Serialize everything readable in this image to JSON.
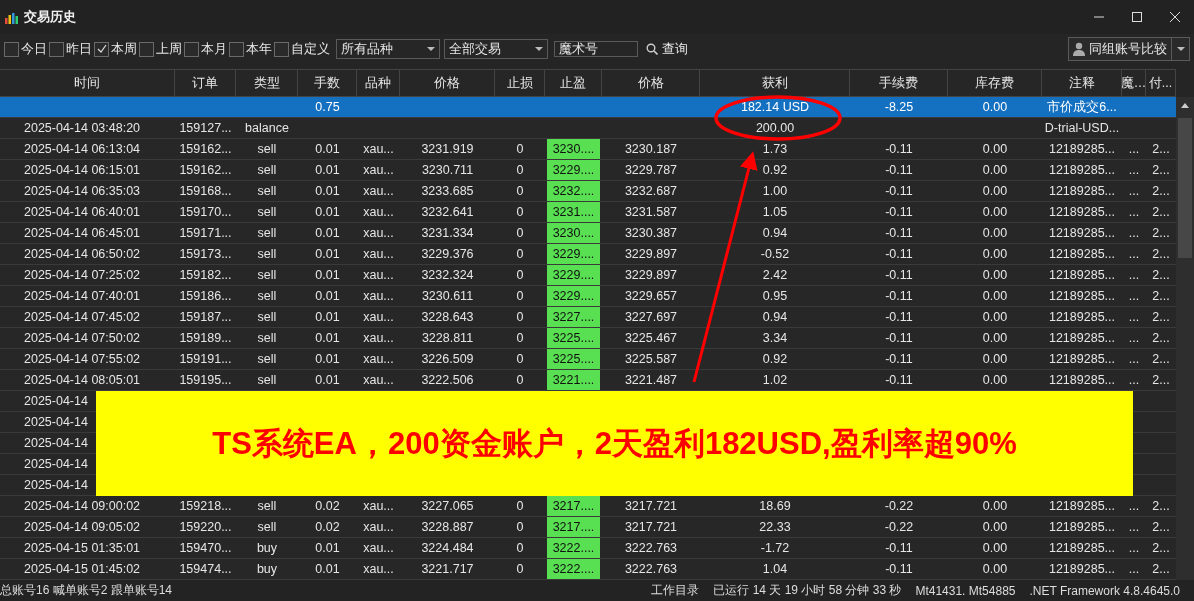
{
  "window": {
    "title": "交易历史"
  },
  "filters": [
    {
      "label": "今日",
      "checked": false
    },
    {
      "label": "昨日",
      "checked": false
    },
    {
      "label": "本周",
      "checked": true
    },
    {
      "label": "上周",
      "checked": false
    },
    {
      "label": "本月",
      "checked": false
    },
    {
      "label": "本年",
      "checked": false
    },
    {
      "label": "自定义",
      "checked": false
    }
  ],
  "dropdowns": [
    "所有品种",
    "全部交易"
  ],
  "magic_field": {
    "placeholder": "魔术号"
  },
  "search_button": "查询",
  "compare_button": "同组账号比较",
  "table": {
    "columns": [
      "时间",
      "订单",
      "类型",
      "手数",
      "品种",
      "价格",
      "止损",
      "止盈",
      "价格",
      "获利",
      "手续费",
      "库存费",
      "注释",
      "魔…",
      "付..."
    ],
    "rows": [
      {
        "selected": true,
        "lots": "0.75",
        "profit": "182.14 USD",
        "commission": "-8.25",
        "swap": "0.00",
        "comment": "市价成交6..."
      },
      {
        "selected": false,
        "time": "2025-04-14 03:48:20",
        "order": "159127...",
        "type": "balance",
        "profit": "200.00",
        "comment": "D-trial-USD..."
      },
      {
        "selected": false,
        "time": "2025-04-14 06:13:04",
        "order": "159162...",
        "type": "sell",
        "lots": "0.01",
        "symbol": "xau...",
        "price": "3231.919",
        "sl": "0",
        "tp": "3230....",
        "close_price": "3230.187",
        "profit": "1.73",
        "commission": "-0.11",
        "swap": "0.00",
        "comment": "12189285...",
        "column_14": "...",
        "column_15": "2..."
      },
      {
        "selected": false,
        "time": "2025-04-14 06:15:01",
        "order": "159162...",
        "type": "sell",
        "lots": "0.01",
        "symbol": "xau...",
        "price": "3230.711",
        "sl": "0",
        "tp": "3229....",
        "close_price": "3229.787",
        "profit": "0.92",
        "commission": "-0.11",
        "swap": "0.00",
        "comment": "12189285...",
        "column_14": "...",
        "column_15": "2..."
      },
      {
        "selected": false,
        "time": "2025-04-14 06:35:03",
        "order": "159168...",
        "type": "sell",
        "lots": "0.01",
        "symbol": "xau...",
        "price": "3233.685",
        "sl": "0",
        "tp": "3232....",
        "close_price": "3232.687",
        "profit": "1.00",
        "commission": "-0.11",
        "swap": "0.00",
        "comment": "12189285...",
        "column_14": "...",
        "column_15": "2..."
      },
      {
        "selected": false,
        "time": "2025-04-14 06:40:01",
        "order": "159170...",
        "type": "sell",
        "lots": "0.01",
        "symbol": "xau...",
        "price": "3232.641",
        "sl": "0",
        "tp": "3231....",
        "close_price": "3231.587",
        "profit": "1.05",
        "commission": "-0.11",
        "swap": "0.00",
        "comment": "12189285...",
        "column_14": "...",
        "column_15": "2..."
      },
      {
        "selected": false,
        "time": "2025-04-14 06:45:01",
        "order": "159171...",
        "type": "sell",
        "lots": "0.01",
        "symbol": "xau...",
        "price": "3231.334",
        "sl": "0",
        "tp": "3230....",
        "close_price": "3230.387",
        "profit": "0.94",
        "commission": "-0.11",
        "swap": "0.00",
        "comment": "12189285...",
        "column_14": "...",
        "column_15": "2..."
      },
      {
        "selected": false,
        "time": "2025-04-14 06:50:02",
        "order": "159173...",
        "type": "sell",
        "lots": "0.01",
        "symbol": "xau...",
        "price": "3229.376",
        "sl": "0",
        "tp": "3229....",
        "close_price": "3229.897",
        "profit": "-0.52",
        "commission": "-0.11",
        "swap": "0.00",
        "comment": "12189285...",
        "column_14": "...",
        "column_15": "2..."
      },
      {
        "selected": false,
        "time": "2025-04-14 07:25:02",
        "order": "159182...",
        "type": "sell",
        "lots": "0.01",
        "symbol": "xau...",
        "price": "3232.324",
        "sl": "0",
        "tp": "3229....",
        "close_price": "3229.897",
        "profit": "2.42",
        "commission": "-0.11",
        "swap": "0.00",
        "comment": "12189285...",
        "column_14": "...",
        "column_15": "2..."
      },
      {
        "selected": false,
        "time": "2025-04-14 07:40:01",
        "order": "159186...",
        "type": "sell",
        "lots": "0.01",
        "symbol": "xau...",
        "price": "3230.611",
        "sl": "0",
        "tp": "3229....",
        "close_price": "3229.657",
        "profit": "0.95",
        "commission": "-0.11",
        "swap": "0.00",
        "comment": "12189285...",
        "column_14": "...",
        "column_15": "2..."
      },
      {
        "selected": false,
        "time": "2025-04-14 07:45:02",
        "order": "159187...",
        "type": "sell",
        "lots": "0.01",
        "symbol": "xau...",
        "price": "3228.643",
        "sl": "0",
        "tp": "3227....",
        "close_price": "3227.697",
        "profit": "0.94",
        "commission": "-0.11",
        "swap": "0.00",
        "comment": "12189285...",
        "column_14": "...",
        "column_15": "2..."
      },
      {
        "selected": false,
        "time": "2025-04-14 07:50:02",
        "order": "159189...",
        "type": "sell",
        "lots": "0.01",
        "symbol": "xau...",
        "price": "3228.811",
        "sl": "0",
        "tp": "3225....",
        "close_price": "3225.467",
        "profit": "3.34",
        "commission": "-0.11",
        "swap": "0.00",
        "comment": "12189285...",
        "column_14": "...",
        "column_15": "2..."
      },
      {
        "selected": false,
        "time": "2025-04-14 07:55:02",
        "order": "159191...",
        "type": "sell",
        "lots": "0.01",
        "symbol": "xau...",
        "price": "3226.509",
        "sl": "0",
        "tp": "3225....",
        "close_price": "3225.587",
        "profit": "0.92",
        "commission": "-0.11",
        "swap": "0.00",
        "comment": "12189285...",
        "column_14": "...",
        "column_15": "2..."
      },
      {
        "selected": false,
        "time": "2025-04-14 08:05:01",
        "order": "159195...",
        "type": "sell",
        "lots": "0.01",
        "symbol": "xau...",
        "price": "3222.506",
        "sl": "0",
        "tp": "3221....",
        "close_price": "3221.487",
        "profit": "1.02",
        "commission": "-0.11",
        "swap": "0.00",
        "comment": "12189285...",
        "column_14": "...",
        "column_15": "2..."
      },
      {
        "selected": false,
        "time": "2025-04-14"
      },
      {
        "selected": false,
        "time": "2025-04-14"
      },
      {
        "selected": false,
        "time": "2025-04-14"
      },
      {
        "selected": false,
        "time": "2025-04-14"
      },
      {
        "selected": false,
        "time": "2025-04-14"
      },
      {
        "selected": false,
        "time": "2025-04-14 09:00:02",
        "order": "159218...",
        "type": "sell",
        "lots": "0.02",
        "symbol": "xau...",
        "price": "3227.065",
        "sl": "0",
        "tp": "3217....",
        "close_price": "3217.721",
        "profit": "18.69",
        "commission": "-0.22",
        "swap": "0.00",
        "comment": "12189285...",
        "column_14": "...",
        "column_15": "2..."
      },
      {
        "selected": false,
        "time": "2025-04-14 09:05:02",
        "order": "159220...",
        "type": "sell",
        "lots": "0.02",
        "symbol": "xau...",
        "price": "3228.887",
        "sl": "0",
        "tp": "3217....",
        "close_price": "3217.721",
        "profit": "22.33",
        "commission": "-0.22",
        "swap": "0.00",
        "comment": "12189285...",
        "column_14": "...",
        "column_15": "2..."
      },
      {
        "selected": false,
        "time": "2025-04-15 01:35:01",
        "order": "159470...",
        "type": "buy",
        "lots": "0.01",
        "symbol": "xau...",
        "price": "3224.484",
        "sl": "0",
        "tp": "3222....",
        "close_price": "3222.763",
        "profit": "-1.72",
        "commission": "-0.11",
        "swap": "0.00",
        "comment": "12189285...",
        "column_14": "...",
        "column_15": "2..."
      },
      {
        "selected": false,
        "time": "2025-04-15 01:45:02",
        "order": "159474...",
        "type": "buy",
        "lots": "0.01",
        "symbol": "xau...",
        "price": "3221.717",
        "sl": "0",
        "tp": "3222....",
        "close_price": "3222.763",
        "profit": "1.04",
        "commission": "-0.11",
        "swap": "0.00",
        "comment": "12189285...",
        "column_14": "...",
        "column_15": "2..."
      }
    ]
  },
  "status_bar": {
    "left": "总账号16 喊单账号2 跟单账号14",
    "items": [
      "工作目录",
      "已运行 14 天 19 小时 58 分钟 33 秒",
      "Mt41431. Mt54885",
      ".NET Framework 4.8.4645.0"
    ]
  },
  "banner": {
    "text": "TS系统EA，200资金账户，2天盈利182USD,盈利率超90%"
  }
}
